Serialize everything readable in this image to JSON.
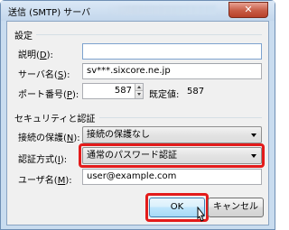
{
  "window": {
    "title": "送信 (SMTP) サーバ",
    "close_glyph": "✕"
  },
  "settings_group": {
    "label": "設定",
    "description": {
      "label_text": "説明(",
      "mnemonic": "D",
      "label_suffix": "):",
      "value": ""
    },
    "server_name": {
      "label_text": "サーバ名(",
      "mnemonic": "S",
      "label_suffix": "):",
      "value": "sv***.sixcore.ne.jp"
    },
    "port": {
      "label_text": "ポート番号(",
      "mnemonic": "P",
      "label_suffix": "):",
      "value": "587",
      "default_label": "既定値:",
      "default_value": "587"
    }
  },
  "security_group": {
    "label": "セキュリティと認証",
    "connection_security": {
      "label_text": "接続の保護(",
      "mnemonic": "N",
      "label_suffix": "):",
      "value": "接続の保護なし"
    },
    "auth_method": {
      "label_text": "認証方式(",
      "mnemonic": "I",
      "label_suffix": "):",
      "value": "通常のパスワード認証"
    },
    "username": {
      "label_text": "ユーザ名(",
      "mnemonic": "M",
      "label_suffix": "):",
      "value": "user@example.com"
    }
  },
  "buttons": {
    "ok": "OK",
    "cancel": "キャンセル"
  },
  "colors": {
    "highlight": "#e31b1b",
    "title_bar": "#c9dcef",
    "close_button": "#c75b45"
  }
}
